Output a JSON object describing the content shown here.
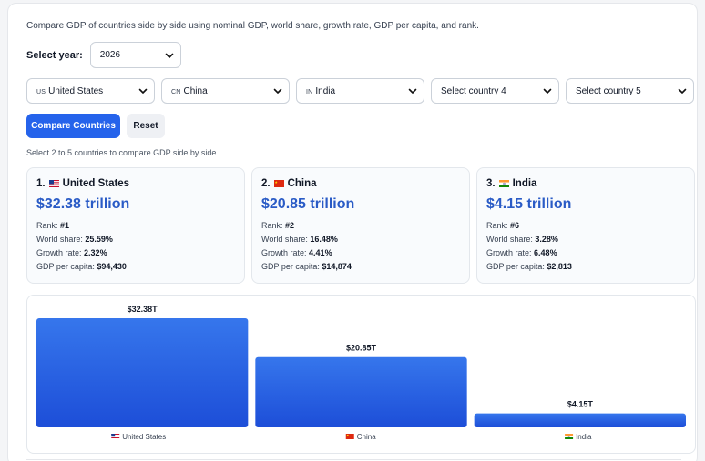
{
  "intro": "Compare GDP of countries side by side using nominal GDP, world share, growth rate, GDP per capita, and rank.",
  "year": {
    "label": "Select year:",
    "value": "2026"
  },
  "country_selects": [
    {
      "code": "US",
      "value": "United States"
    },
    {
      "code": "CN",
      "value": "China"
    },
    {
      "code": "IN",
      "value": "India"
    },
    {
      "code": "",
      "value": "Select country 4"
    },
    {
      "code": "",
      "value": "Select country 5"
    }
  ],
  "buttons": {
    "compare": "Compare Countries",
    "reset": "Reset"
  },
  "hint": "Select 2 to 5 countries to compare GDP side by side.",
  "stat_labels": {
    "rank": "Rank:",
    "share": "World share:",
    "growth": "Growth rate:",
    "per_capita": "GDP per capita:"
  },
  "cards": [
    {
      "number": "1.",
      "name": "United States",
      "flag": "us-flag-icon",
      "gdp": "$32.38 trillion",
      "rank": "#1",
      "share": "25.59%",
      "growth": "2.32%",
      "per_capita": "$94,430"
    },
    {
      "number": "2.",
      "name": "China",
      "flag": "cn-flag-icon",
      "gdp": "$20.85 trillion",
      "rank": "#2",
      "share": "16.48%",
      "growth": "4.41%",
      "per_capita": "$14,874"
    },
    {
      "number": "3.",
      "name": "India",
      "flag": "in-flag-icon",
      "gdp": "$4.15 trillion",
      "rank": "#6",
      "share": "3.28%",
      "growth": "6.48%",
      "per_capita": "$2,813"
    }
  ],
  "colors": {
    "accent": "#2563eb",
    "bar_top": "#3676ec",
    "bar_bottom": "#1d4ed8",
    "value_blue": "#2a5bc6"
  },
  "chart_data": {
    "type": "bar",
    "categories": [
      "United States",
      "China",
      "India"
    ],
    "flags": [
      "us-flag-icon",
      "cn-flag-icon",
      "in-flag-icon"
    ],
    "values": [
      32.38,
      20.85,
      4.15
    ],
    "value_labels": [
      "$32.38T",
      "$20.85T",
      "$4.15T"
    ],
    "ylim": [
      0,
      32.38
    ],
    "grid": false,
    "title": "",
    "xlabel": "",
    "ylabel": ""
  }
}
